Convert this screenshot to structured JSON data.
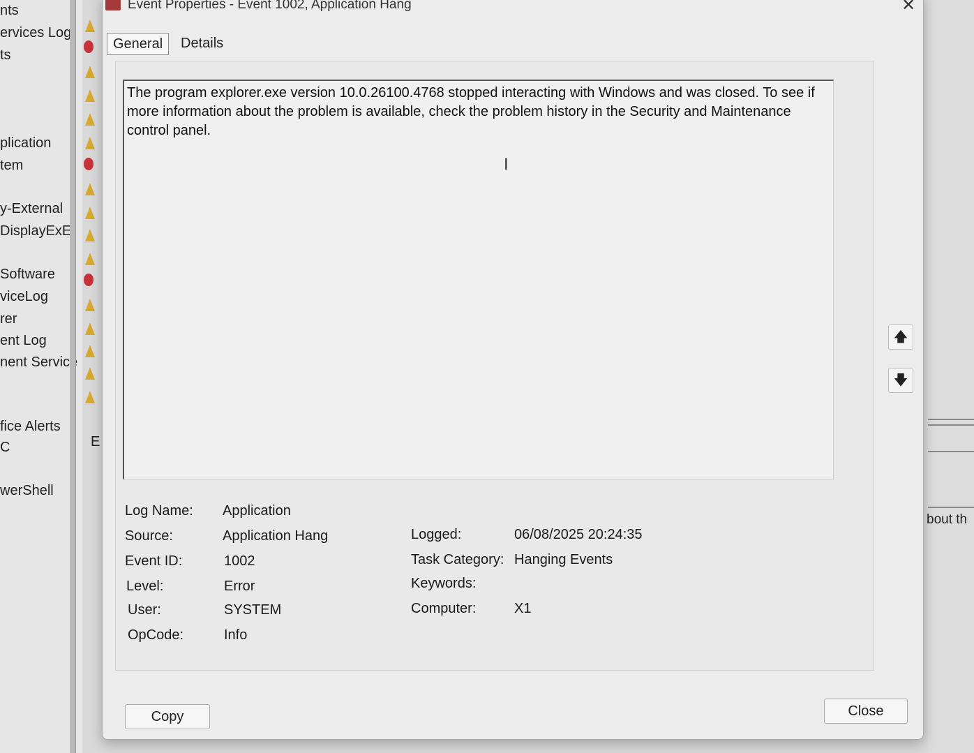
{
  "background": {
    "tree_items": [
      "nts",
      "ervices Log",
      "ts",
      "plication",
      "tem",
      "y-External",
      "DisplayExE",
      "Software",
      "viceLog",
      "rer",
      "ent Log",
      "nent Service",
      "fice Alerts",
      "C",
      "werShell"
    ],
    "column_letter": "E",
    "right_text": "bout th"
  },
  "dialog": {
    "title": "Event Properties - Event 1002, Application Hang",
    "tabs": [
      {
        "label": "General",
        "active": true
      },
      {
        "label": "Details",
        "active": false
      }
    ],
    "description": "The program explorer.exe version 10.0.26100.4768 stopped interacting with Windows and was closed. To see if more information about the problem is available, check the problem history in the Security and Maintenance control panel.",
    "properties_left": [
      {
        "label": "Log Name:",
        "value": "Application"
      },
      {
        "label": "Source:",
        "value": "Application Hang"
      },
      {
        "label": "Event ID:",
        "value": "1002"
      },
      {
        "label": "Level:",
        "value": "Error"
      },
      {
        "label": "User:",
        "value": "SYSTEM"
      },
      {
        "label": "OpCode:",
        "value": "Info"
      }
    ],
    "properties_right": [
      {
        "label": "Logged:",
        "value": "06/08/2025 20:24:35"
      },
      {
        "label": "Task Category:",
        "value": "Hanging Events"
      },
      {
        "label": "Keywords:",
        "value": ""
      },
      {
        "label": "Computer:",
        "value": "X1"
      }
    ],
    "buttons": {
      "copy": "Copy",
      "close": "Close"
    },
    "scroll_up_symbol": "🡅",
    "scroll_down_symbol": "🡇",
    "close_symbol": "✕"
  }
}
